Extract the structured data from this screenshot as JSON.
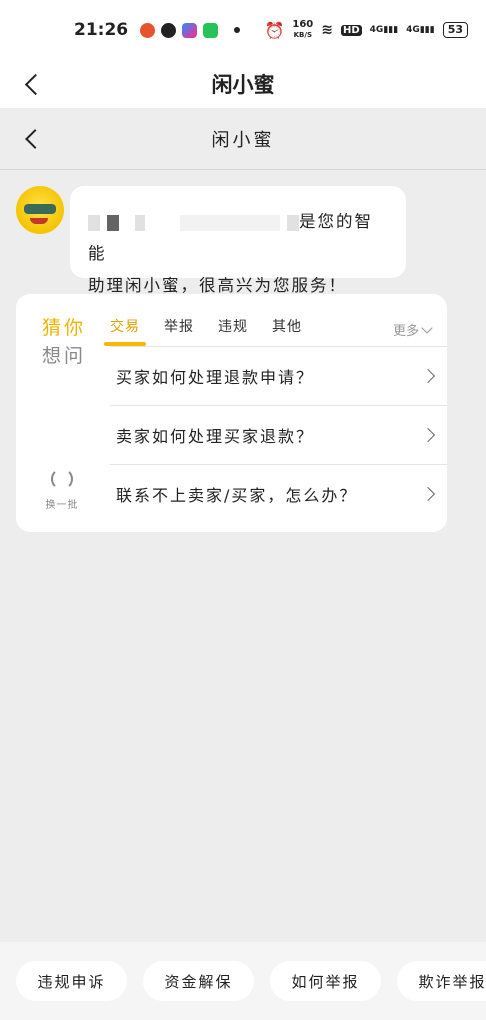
{
  "status_bar": {
    "time": "21:26",
    "network_speed_value": "160",
    "network_speed_unit": "KB/S",
    "hd_label": "HD",
    "signal_1": "4G",
    "signal_2": "4G",
    "battery": "53"
  },
  "header": {
    "title": "闲小蜜"
  },
  "chat": {
    "title": "闲小蜜",
    "welcome_visible_text": "是您的智能",
    "welcome_line2": "助理闲小蜜，很高兴为您服务！"
  },
  "suggestions": {
    "label_line1": "猜你",
    "label_line2": "想问",
    "refresh_label": "换一批",
    "tabs": [
      {
        "label": "交易"
      },
      {
        "label": "举报"
      },
      {
        "label": "违规"
      },
      {
        "label": "其他"
      }
    ],
    "more_label": "更多",
    "questions": [
      {
        "text": "买家如何处理退款申请？"
      },
      {
        "text": "卖家如何处理买家退款？"
      },
      {
        "text": "联系不上卖家/买家，怎么办？"
      }
    ]
  },
  "quick_actions": [
    {
      "label": "违规申诉"
    },
    {
      "label": "资金解保"
    },
    {
      "label": "如何举报"
    },
    {
      "label": "欺诈举报"
    }
  ],
  "colors": {
    "accent": "#f5b800",
    "background": "#ededed"
  }
}
